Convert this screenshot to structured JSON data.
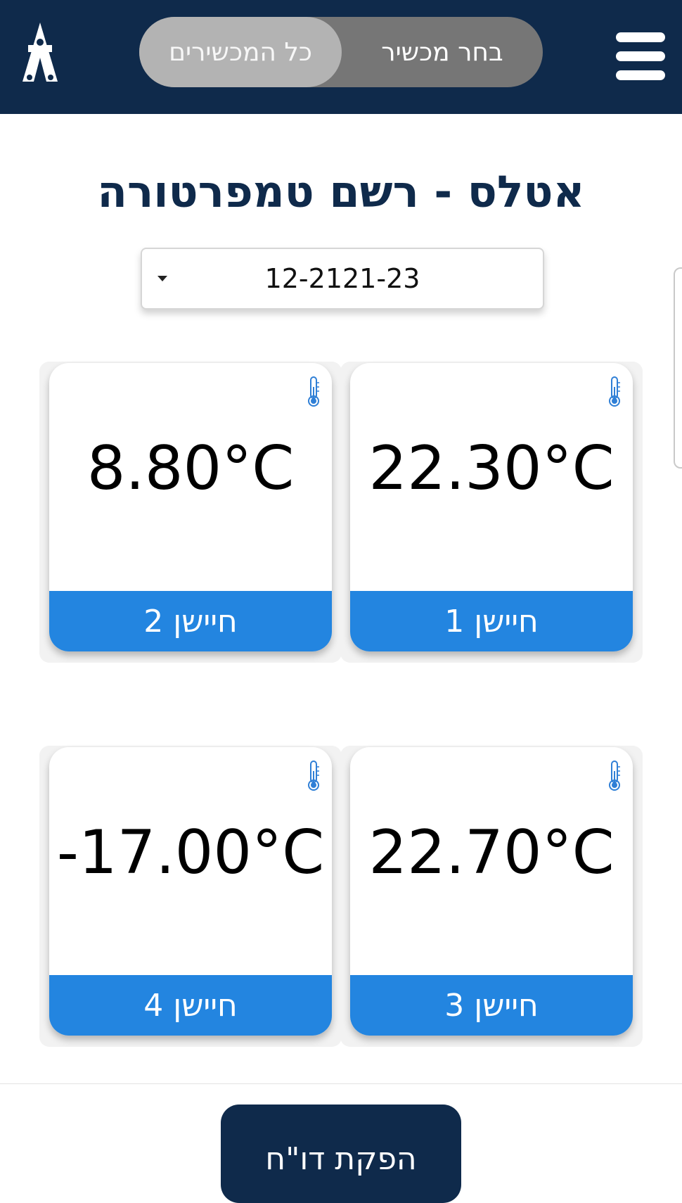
{
  "header": {
    "logo_icon": "atlas-logo-icon",
    "toggle": {
      "all_devices_label": "כל המכשירים",
      "select_device_label": "בחר מכשיר"
    },
    "menu_icon": "hamburger-menu-icon",
    "background_color": "#0f2a4b"
  },
  "page_title": "אטלס - רשם טמפרטורה",
  "device_select": {
    "value": "12-2121-23"
  },
  "sensors": [
    {
      "label": "חיישן 1",
      "value": "22.30°C",
      "icon": "thermometer-icon"
    },
    {
      "label": "חיישן 2",
      "value": "8.80°C",
      "icon": "thermometer-icon"
    },
    {
      "label": "חיישן 3",
      "value": "22.70°C",
      "icon": "thermometer-icon"
    },
    {
      "label": "חיישן 4",
      "value": "-17.00°C",
      "icon": "thermometer-icon"
    }
  ],
  "report_button": {
    "label": "הפקת דו\"ח"
  },
  "colors": {
    "accent": "#2385e0",
    "brand": "#0f2a4b"
  }
}
